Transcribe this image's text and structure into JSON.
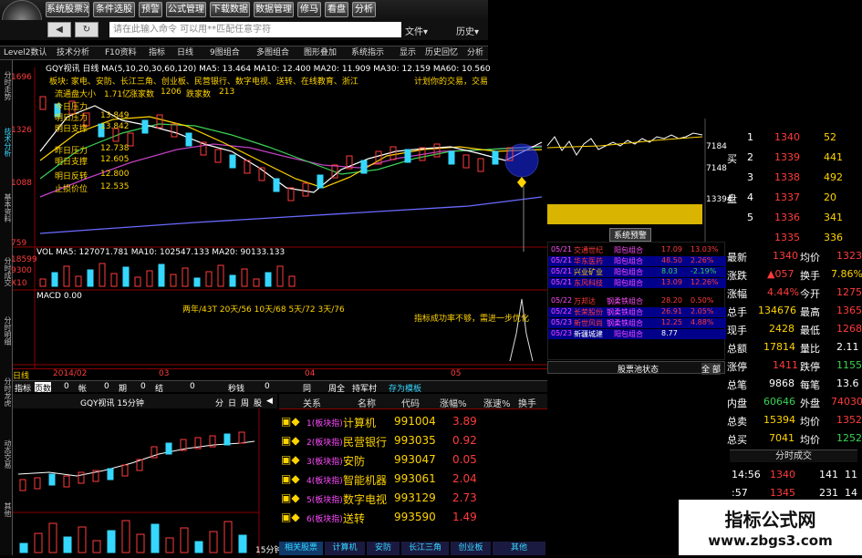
{
  "toolbar": {
    "buttons": [
      "系统股票池",
      "条件选股",
      "预警",
      "公式管理",
      "下载数据",
      "数据管理",
      "修马",
      "看盘",
      "分析"
    ],
    "nav_back": "◀",
    "command_placeholder": "请在此输入命令   可以用**匹配任意字符",
    "menu_file": "文件▾",
    "menu_right": "历史▾"
  },
  "tabs": [
    "Level2数认",
    "技术分析",
    "F10资料",
    "指标",
    "日线",
    "9图组合",
    "多图组合",
    "图形叠加",
    "系统指示",
    "显示",
    "历史回忆",
    "分析"
  ],
  "left_tabs": [
    "分时走势",
    "技术分析",
    "基本资料",
    "分时成交",
    "分时明细",
    "分时龙虎",
    "动态交易",
    "其他"
  ],
  "chart": {
    "header_line": "GQY视讯  日线  MA(5,10,20,30,60,120)  MA5: 13.464  MA10: 12.400  MA20: 11.909  MA30: 12.159  MA60: 10.560",
    "info_line1": "板块: 家电、安防、长江三角、创业板、民营银行、数字电视、送转、在线教育、浙江",
    "info_line2": "计划你的交易，交易",
    "stats": [
      {
        "label": "流通盘大小",
        "value": "1.71亿"
      },
      {
        "label": "涨家数",
        "value": "1206"
      },
      {
        "label": "跌家数",
        "value": "213"
      }
    ],
    "levels": [
      {
        "label": "今日压力",
        "value": ""
      },
      {
        "label": "明日压力",
        "value": "13.849"
      },
      {
        "label": "明日支撑",
        "value": "13.842"
      },
      {
        "label": "昨日压力",
        "value": "12.738"
      },
      {
        "label": "明日支撑",
        "value": "12.605"
      },
      {
        "label": "明日反转",
        "value": "12.800"
      },
      {
        "label": "止损价位",
        "value": "12.535"
      }
    ],
    "y_ticks": [
      "1696",
      "1326",
      "1088",
      "759"
    ],
    "vol_header": "VOL  MA5: 127071.781  MA10: 102547.133  MA20: 90133.133",
    "vol_ticks": [
      "18599",
      "9300",
      "X10"
    ],
    "macd_header": "MACD  0.00",
    "period_stats": "两年/43T   20天/56   10天/68   5天/72   3天/76",
    "notice": "指标成功率不够，需进一步优化",
    "date_bar": [
      "日线",
      "2014/02",
      "03",
      "04",
      "05"
    ],
    "footer_tabs": [
      "指标",
      "页数",
      "0",
      "帐",
      "0",
      "期",
      "0",
      "结",
      "0",
      "秒钱",
      "0",
      "同",
      "周全",
      "持军村",
      "存为模板"
    ]
  },
  "right_panel": {
    "price_ticks": [
      "7184",
      "7148",
      "13394"
    ],
    "signal_btn": "系统预警",
    "order_book": [
      {
        "label": "",
        "price": "1340",
        "vol": "52"
      },
      {
        "label": "买",
        "price": "1339",
        "vol": "441"
      },
      {
        "label": "",
        "price": "1338",
        "vol": "492"
      },
      {
        "label": "盘",
        "price": "1337",
        "vol": "20"
      },
      {
        "label": "",
        "price": "1336",
        "vol": "341"
      },
      {
        "label": "",
        "price": "1335",
        "vol": "336"
      }
    ],
    "book_idx": [
      "1",
      "2",
      "3",
      "4",
      "5"
    ],
    "quotes": [
      {
        "l": "最新",
        "v": "1340",
        "l2": "均价",
        "v2": "1323"
      },
      {
        "l": "涨跌",
        "v": "▲057",
        "l2": "换手",
        "v2": "7.86%"
      },
      {
        "l": "涨幅",
        "v": "4.44%",
        "l2": "今开",
        "v2": "1275"
      },
      {
        "l": "总手",
        "v": "134676",
        "l2": "最高",
        "v2": "1365"
      },
      {
        "l": "现手",
        "v": "2428",
        "l2": "最低",
        "v2": "1268"
      },
      {
        "l": "总额",
        "v": "17814",
        "l2": "量比",
        "v2": "2.11"
      },
      {
        "l": "涨停",
        "v": "1411",
        "l2": "跌停",
        "v2": "1155"
      },
      {
        "l": "总笔",
        "v": "9868",
        "l2": "每笔",
        "v2": "13.6"
      },
      {
        "l": "内盘",
        "v": "60646",
        "l2": "外盘",
        "v2": "74030"
      },
      {
        "l": "总卖",
        "v": "15394",
        "l2": "均价",
        "v2": "1352"
      },
      {
        "l": "总买",
        "v": "7041",
        "l2": "均价",
        "v2": "1252"
      }
    ],
    "tick_title": "分时成交",
    "ticks": [
      {
        "t": "14:56",
        "p": "1340",
        "v": "141",
        "n": "11"
      },
      {
        "t": ":57",
        "p": "1345",
        "v": "231",
        "n": "14"
      }
    ]
  },
  "signals": [
    {
      "date": "05/21",
      "name": "交通世纪",
      "type": "阳包组合",
      "price": "17.09",
      "chg": "13.03%"
    },
    {
      "date": "05/21",
      "name": "华东医药",
      "type": "阳包组合",
      "price": "48.50",
      "chg": "2.26%"
    },
    {
      "date": "05/21",
      "name": "兴业矿业",
      "type": "阳包组合",
      "price": "8.03",
      "chg": "-2.19%"
    },
    {
      "date": "05/21",
      "name": "东风科技",
      "type": "阳包组合",
      "price": "13.09",
      "chg": "12.26%"
    },
    {
      "date": "05/22",
      "name": "万邦达",
      "type": "钢柔铁组合",
      "price": "28.20",
      "chg": "0.50%"
    },
    {
      "date": "05/22",
      "name": "长荣股份",
      "type": "钢柔铁组合",
      "price": "26.91",
      "chg": "2.05%"
    },
    {
      "date": "05/23",
      "name": "新世风尚",
      "type": "钢柔铁组合",
      "price": "12.25",
      "chg": "4.88%"
    },
    {
      "date": "05/23",
      "name": "新疆城建",
      "type": "阳包组合",
      "price": "8.77",
      "chg": ""
    }
  ],
  "signal_footer": {
    "status": "股票池状态",
    "btn": "全 部"
  },
  "mini_chart": {
    "header": "GQY视讯  15分钟",
    "tabs": [
      "分",
      "日",
      "周",
      "股",
      "◀"
    ],
    "scale": "15分钟"
  },
  "sector_table": {
    "headers": [
      "关系",
      "名称",
      "代码",
      "涨幅%",
      "涨速%",
      "换手"
    ],
    "rows": [
      {
        "rel": "1(板块指)",
        "name": "计算机",
        "code": "991004",
        "chg": "3.89"
      },
      {
        "rel": "2(板块指)",
        "name": "民营银行",
        "code": "993035",
        "chg": "0.92"
      },
      {
        "rel": "3(板块指)",
        "name": "安防",
        "code": "993047",
        "chg": "0.05"
      },
      {
        "rel": "4(板块指)",
        "name": "智能机器",
        "code": "993061",
        "chg": "2.04"
      },
      {
        "rel": "5(板块指)",
        "name": "数字电视",
        "code": "993129",
        "chg": "2.73"
      },
      {
        "rel": "6(板块指)",
        "name": "送转",
        "code": "993590",
        "chg": "1.49"
      }
    ],
    "bottom_tabs": [
      "相关股票",
      "计算机",
      "安防",
      "长江三角",
      "创业板",
      "其他"
    ]
  },
  "watermark": {
    "title": "指标公式网",
    "url": "www.zbgs3.com"
  },
  "colors": {
    "up": "#ff3b3b",
    "down": "#35d7ff",
    "ma5": "#ffffff",
    "ma10": "#ffd400",
    "ma20": "#ff4cff",
    "ma30": "#39d353",
    "ma60": "#6a6aff",
    "ma120": "#c040c0"
  }
}
